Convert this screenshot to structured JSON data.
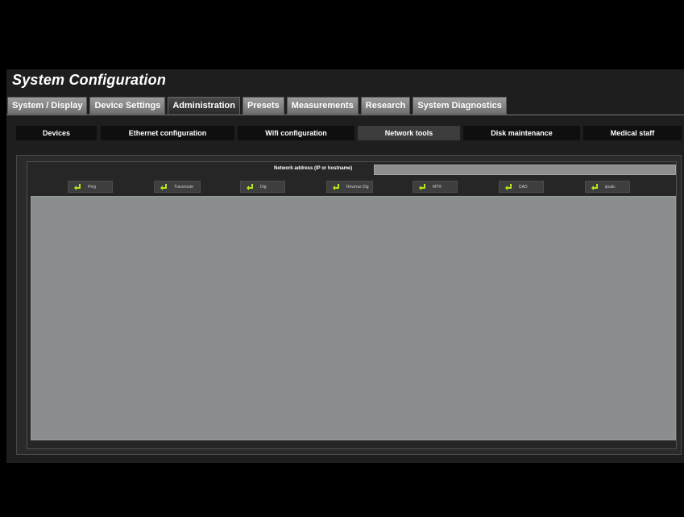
{
  "window": {
    "title": "System Configuration"
  },
  "main_tabs": [
    {
      "label": "System / Display"
    },
    {
      "label": "Device Settings"
    },
    {
      "label": "Administration"
    },
    {
      "label": "Presets"
    },
    {
      "label": "Measurements"
    },
    {
      "label": "Research"
    },
    {
      "label": "System Diagnostics"
    }
  ],
  "active_main_tab": "Administration",
  "sub_tabs": [
    {
      "label": "Devices"
    },
    {
      "label": "Ethernet configuration"
    },
    {
      "label": "Wifi configuration"
    },
    {
      "label": "Network tools"
    },
    {
      "label": "Disk maintenance"
    },
    {
      "label": "Medical staff"
    }
  ],
  "active_sub_tab": "Network tools",
  "network": {
    "address_label": "Network address (IP or hostname)",
    "address_value": "",
    "tools": [
      {
        "label": "Ping",
        "icon": "enter-arrow-icon"
      },
      {
        "label": "Traceroute",
        "icon": "enter-arrow-icon"
      },
      {
        "label": "Dig",
        "icon": "enter-arrow-icon"
      },
      {
        "label": "Reverse Dig",
        "icon": "enter-arrow-icon"
      },
      {
        "label": "MTR",
        "icon": "enter-arrow-icon"
      },
      {
        "label": "DAD",
        "icon": "enter-arrow-icon"
      },
      {
        "label": "ipcalc",
        "icon": "enter-arrow-icon"
      }
    ],
    "output_text": ""
  },
  "colors": {
    "background": "#000000",
    "panel": "#1e1e1e",
    "tab_inactive": "#8a8a8a",
    "tab_active": "#3a3a3a",
    "icon_green": "#b5e61d",
    "output_area": "#8b8e8e"
  }
}
